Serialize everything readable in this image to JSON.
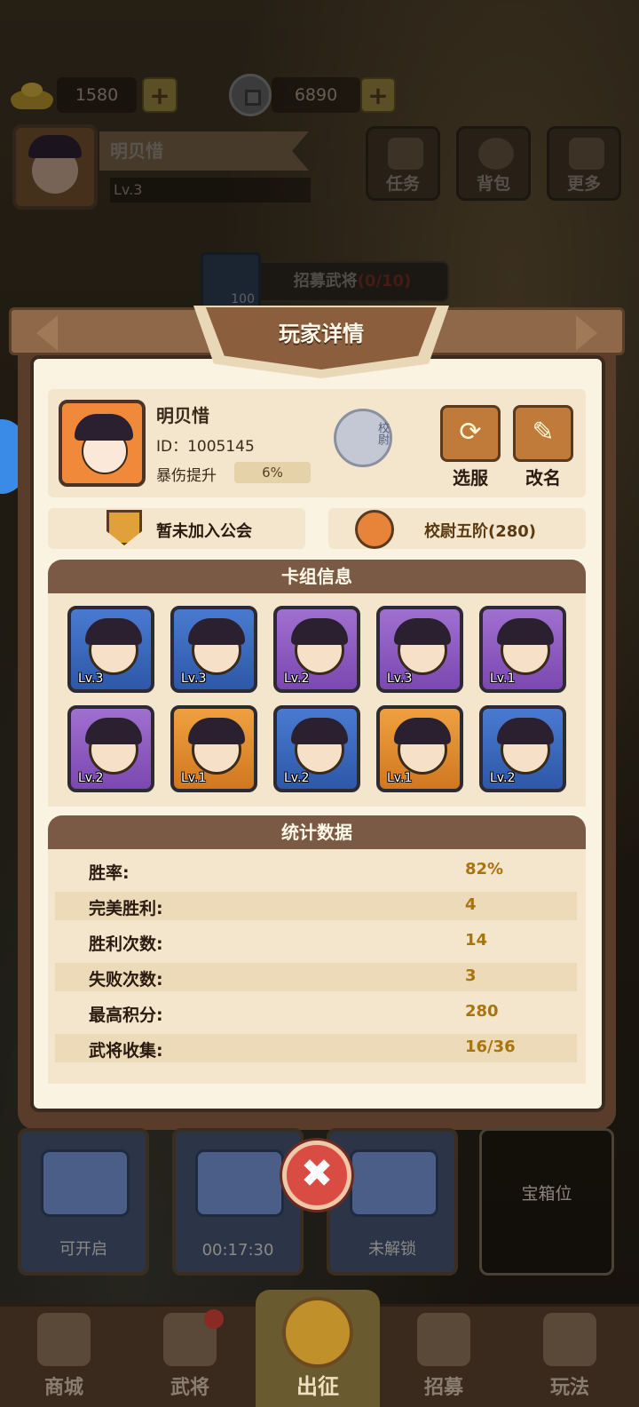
{
  "currency": {
    "gold": "1580",
    "coins": "6890",
    "plus": "+"
  },
  "profile": {
    "name": "明贝惜",
    "level": "Lv.3"
  },
  "top_buttons": {
    "tasks": "任务",
    "bag": "背包",
    "more": "更多"
  },
  "recruit": {
    "cost": "100",
    "label": "招募武将",
    "progress": "(0/10)"
  },
  "modal": {
    "title": "玩家详情",
    "player": {
      "name": "明贝惜",
      "id": "ID：1005145",
      "crit_label": "暴伤提升",
      "crit_value": "6%",
      "rank_emblem_text": "校尉"
    },
    "actions": {
      "switch_server": "选服",
      "rename": "改名",
      "switch_icon": "⟳",
      "rename_icon": "✎"
    },
    "guild": "暂未加入公会",
    "rank": "校尉五阶(280)",
    "deck": {
      "title": "卡组信息",
      "cards": [
        {
          "level": "Lv.3",
          "rarity": "blue"
        },
        {
          "level": "Lv.3",
          "rarity": "blue"
        },
        {
          "level": "Lv.2",
          "rarity": "purple"
        },
        {
          "level": "Lv.3",
          "rarity": "purple"
        },
        {
          "level": "Lv.1",
          "rarity": "purple"
        },
        {
          "level": "Lv.2",
          "rarity": "purple"
        },
        {
          "level": "Lv.1",
          "rarity": "orange"
        },
        {
          "level": "Lv.2",
          "rarity": "blue"
        },
        {
          "level": "Lv.1",
          "rarity": "orange"
        },
        {
          "level": "Lv.2",
          "rarity": "blue"
        }
      ]
    },
    "stats": {
      "title": "统计数据",
      "rows": [
        {
          "label": "胜率:",
          "value": "82%"
        },
        {
          "label": "完美胜利:",
          "value": "4"
        },
        {
          "label": "胜利次数:",
          "value": "14"
        },
        {
          "label": "失败次数:",
          "value": "3"
        },
        {
          "label": "最高积分:",
          "value": "280"
        },
        {
          "label": "武将收集:",
          "value": "16/36"
        }
      ]
    },
    "close_icon": "✖"
  },
  "chests": [
    {
      "label": "可开启"
    },
    {
      "label": "00:17:30"
    },
    {
      "label": "未解锁"
    },
    {
      "label": "宝箱位"
    }
  ],
  "nav": {
    "shop": "商城",
    "generals": "武将",
    "battle": "出征",
    "recruit": "招募",
    "gameplay": "玩法"
  }
}
